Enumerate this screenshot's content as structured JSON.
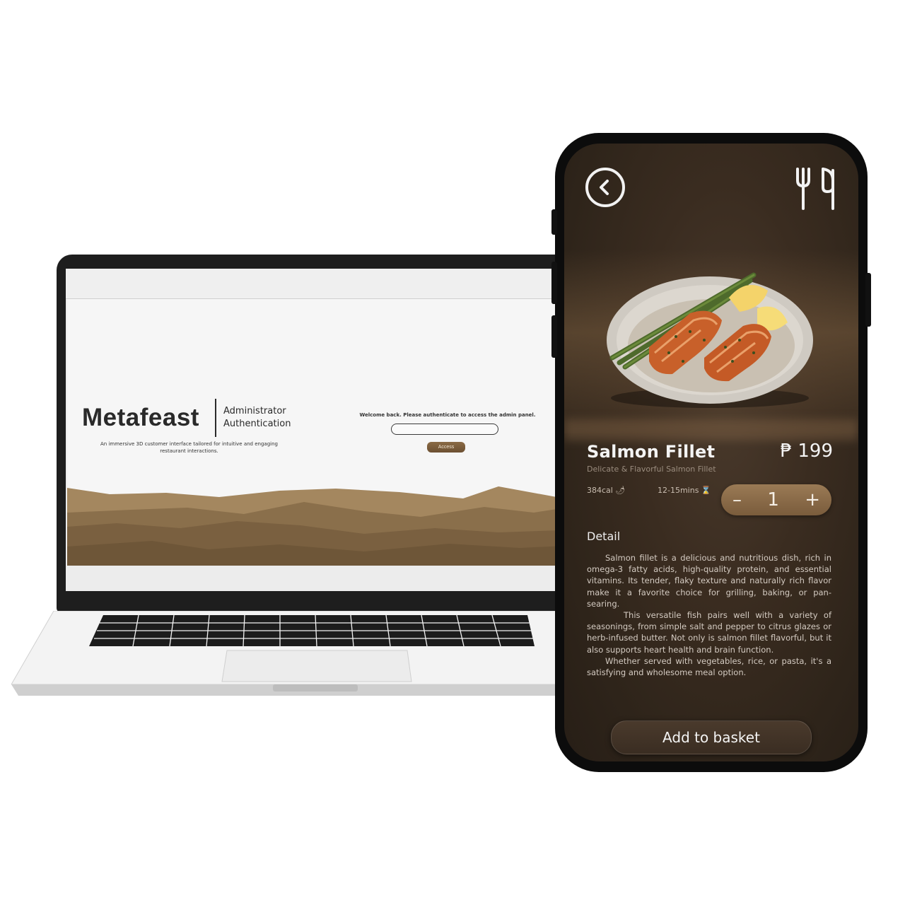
{
  "laptop": {
    "brand": "Metafeast",
    "subtitle_line1": "Administrator",
    "subtitle_line2": "Authentication",
    "tagline": "An immersive 3D customer interface tailored for intuitive and engaging restaurant interactions.",
    "login_prompt": "Welcome back. Please authenticate to access the admin panel.",
    "password_value": "",
    "access_label": "Access"
  },
  "phone": {
    "dish_name": "Salmon Fillet",
    "price": "₱ 199",
    "subtitle": "Delicate & Flavorful Salmon Fillet",
    "calories": "384cal 🌶",
    "time": "12-15mins ⌛",
    "quantity": "1",
    "minus_label": "–",
    "plus_label": "+",
    "detail_heading": "Detail",
    "detail_p1": "Salmon fillet is a delicious and nutritious dish, rich in omega-3 fatty acids, high-quality protein, and essential vitamins. Its tender, flaky texture and naturally rich flavor make it a favorite choice for grilling, baking, or pan-searing.",
    "detail_p2": "This versatile fish pairs well with a variety of seasonings, from simple salt and pepper to citrus glazes or herb-infused butter. Not only is salmon fillet flavorful, but it also supports heart health and brain function.",
    "detail_p3": "Whether served with vegetables, rice, or pasta, it's a satisfying and wholesome meal option.",
    "add_button": "Add to basket"
  },
  "colors": {
    "accent_brown": "#7a5c3c",
    "phone_bg": "#2e241a",
    "mountain_light": "#9c7f59",
    "mountain_dark": "#6e5638"
  },
  "icons": [
    "back-icon",
    "utensils-icon",
    "flame-icon",
    "hourglass-icon"
  ]
}
